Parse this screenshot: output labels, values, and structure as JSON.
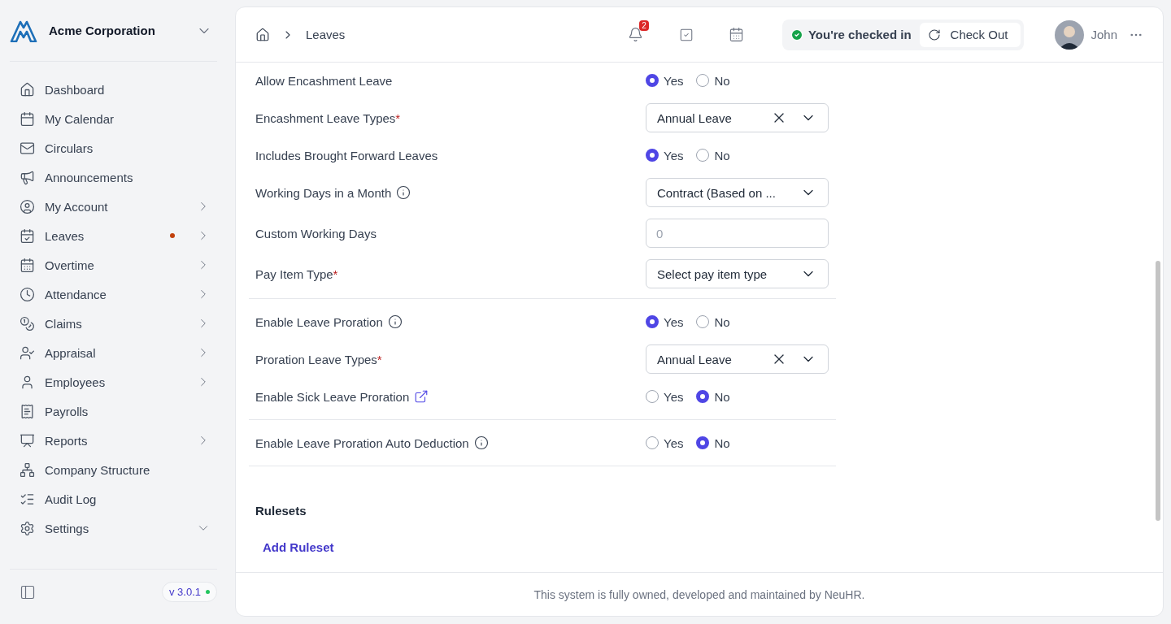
{
  "sidebar": {
    "company": "Acme Corporation",
    "items": [
      {
        "label": "Dashboard",
        "has_submenu": false,
        "alert": false
      },
      {
        "label": "My Calendar",
        "has_submenu": false,
        "alert": false
      },
      {
        "label": "Circulars",
        "has_submenu": false,
        "alert": false
      },
      {
        "label": "Announcements",
        "has_submenu": false,
        "alert": false
      },
      {
        "label": "My Account",
        "has_submenu": true,
        "expanded": false,
        "alert": false
      },
      {
        "label": "Leaves",
        "has_submenu": true,
        "expanded": false,
        "alert": true
      },
      {
        "label": "Overtime",
        "has_submenu": true,
        "expanded": false,
        "alert": false
      },
      {
        "label": "Attendance",
        "has_submenu": true,
        "expanded": false,
        "alert": false
      },
      {
        "label": "Claims",
        "has_submenu": true,
        "expanded": false,
        "alert": false
      },
      {
        "label": "Appraisal",
        "has_submenu": true,
        "expanded": false,
        "alert": false
      },
      {
        "label": "Employees",
        "has_submenu": true,
        "expanded": false,
        "alert": false
      },
      {
        "label": "Payrolls",
        "has_submenu": false,
        "alert": false
      },
      {
        "label": "Reports",
        "has_submenu": true,
        "expanded": false,
        "alert": false
      },
      {
        "label": "Company Structure",
        "has_submenu": false,
        "alert": false
      },
      {
        "label": "Audit Log",
        "has_submenu": false,
        "alert": false
      },
      {
        "label": "Settings",
        "has_submenu": true,
        "expanded": true,
        "alert": false
      }
    ],
    "version": "v 3.0.1"
  },
  "header": {
    "breadcrumb": "Leaves",
    "notification_count": "2",
    "check_status": "You're checked in",
    "check_out": "Check Out",
    "user": "John"
  },
  "sections": [
    [
      {
        "label": "Allow Encashment Leave",
        "info": false,
        "link": false,
        "kind": "radio",
        "options": [
          {
            "label": "Yes",
            "selected": true
          },
          {
            "label": "No",
            "selected": false
          }
        ]
      },
      {
        "label": "Encashment Leave Types",
        "required_mark": "*",
        "info": false,
        "link": false,
        "kind": "select",
        "value": "Annual Leave",
        "clearable": true
      },
      {
        "label": "Includes Brought Forward Leaves",
        "info": false,
        "link": false,
        "kind": "radio",
        "options": [
          {
            "label": "Yes",
            "selected": true
          },
          {
            "label": "No",
            "selected": false
          }
        ]
      },
      {
        "label": "Working Days in a Month",
        "info": true,
        "link": false,
        "kind": "select",
        "value": "Contract (Based on ...",
        "clearable": false
      },
      {
        "label": "Custom Working Days",
        "info": false,
        "link": false,
        "kind": "input",
        "placeholder": "0"
      },
      {
        "label": "Pay Item Type",
        "required_mark": "*",
        "info": false,
        "link": false,
        "kind": "select",
        "value": "Select pay item type",
        "clearable": false
      }
    ],
    [
      {
        "label": "Enable Leave Proration",
        "info": true,
        "link": false,
        "kind": "radio",
        "options": [
          {
            "label": "Yes",
            "selected": true
          },
          {
            "label": "No",
            "selected": false
          }
        ]
      },
      {
        "label": "Proration Leave Types",
        "required_mark": "*",
        "info": false,
        "link": false,
        "kind": "select",
        "value": "Annual Leave",
        "clearable": true
      },
      {
        "label": "Enable Sick Leave Proration",
        "info": false,
        "link": true,
        "kind": "radio",
        "options": [
          {
            "label": "Yes",
            "selected": false
          },
          {
            "label": "No",
            "selected": true
          }
        ]
      }
    ],
    [
      {
        "label": "Enable Leave Proration Auto Deduction",
        "info": true,
        "link": false,
        "kind": "radio",
        "options": [
          {
            "label": "Yes",
            "selected": false
          },
          {
            "label": "No",
            "selected": true
          }
        ]
      }
    ]
  ],
  "rulesets": {
    "title": "Rulesets",
    "add": "Add Ruleset"
  },
  "footer": "This system is fully owned, developed and maintained by NeuHR."
}
